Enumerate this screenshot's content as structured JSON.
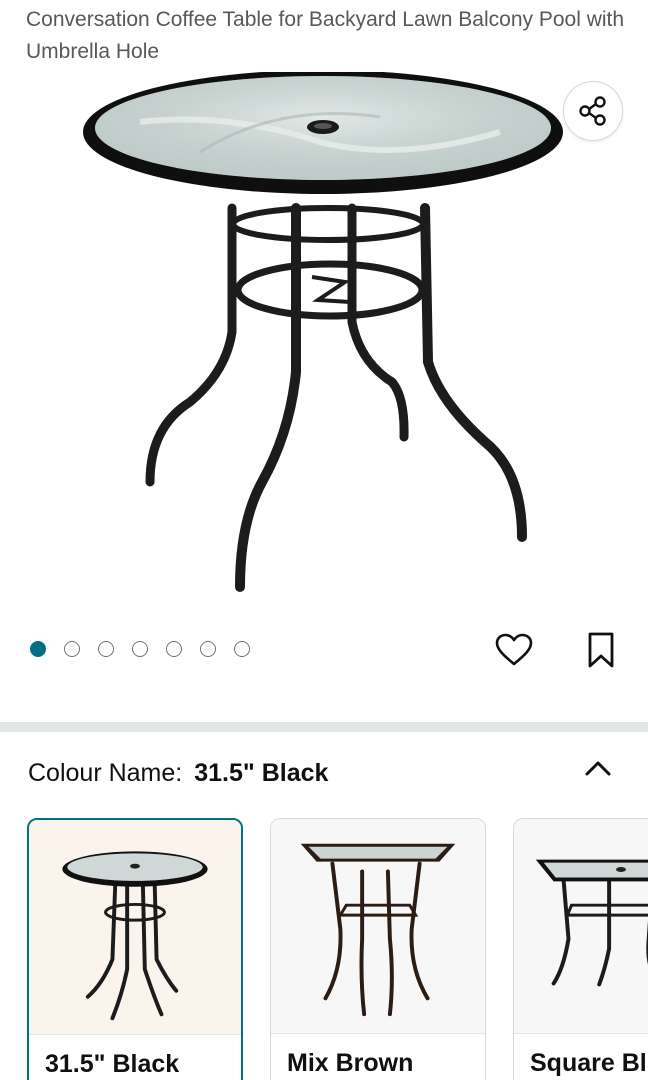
{
  "product": {
    "title": "Conversation Coffee Table for Backyard Lawn Balcony Pool with Umbrella Hole"
  },
  "gallery": {
    "image_count": 7,
    "active_index": 0,
    "share_icon": "share-icon",
    "wishlist_icon": "heart-icon",
    "save_icon": "bookmark-icon"
  },
  "variant": {
    "label": "Colour Name:",
    "selected_value": "31.5\" Black",
    "toggle_icon": "chevron-up-icon",
    "options": [
      {
        "name": "31.5\" Black"
      },
      {
        "name": "Mix Brown"
      },
      {
        "name": "Square Bl"
      }
    ]
  },
  "colors": {
    "accent": "#007185",
    "divider": "#e3e6e6",
    "border": "#d5d9d9",
    "text": "#0f1111",
    "muted_text": "#565959"
  }
}
